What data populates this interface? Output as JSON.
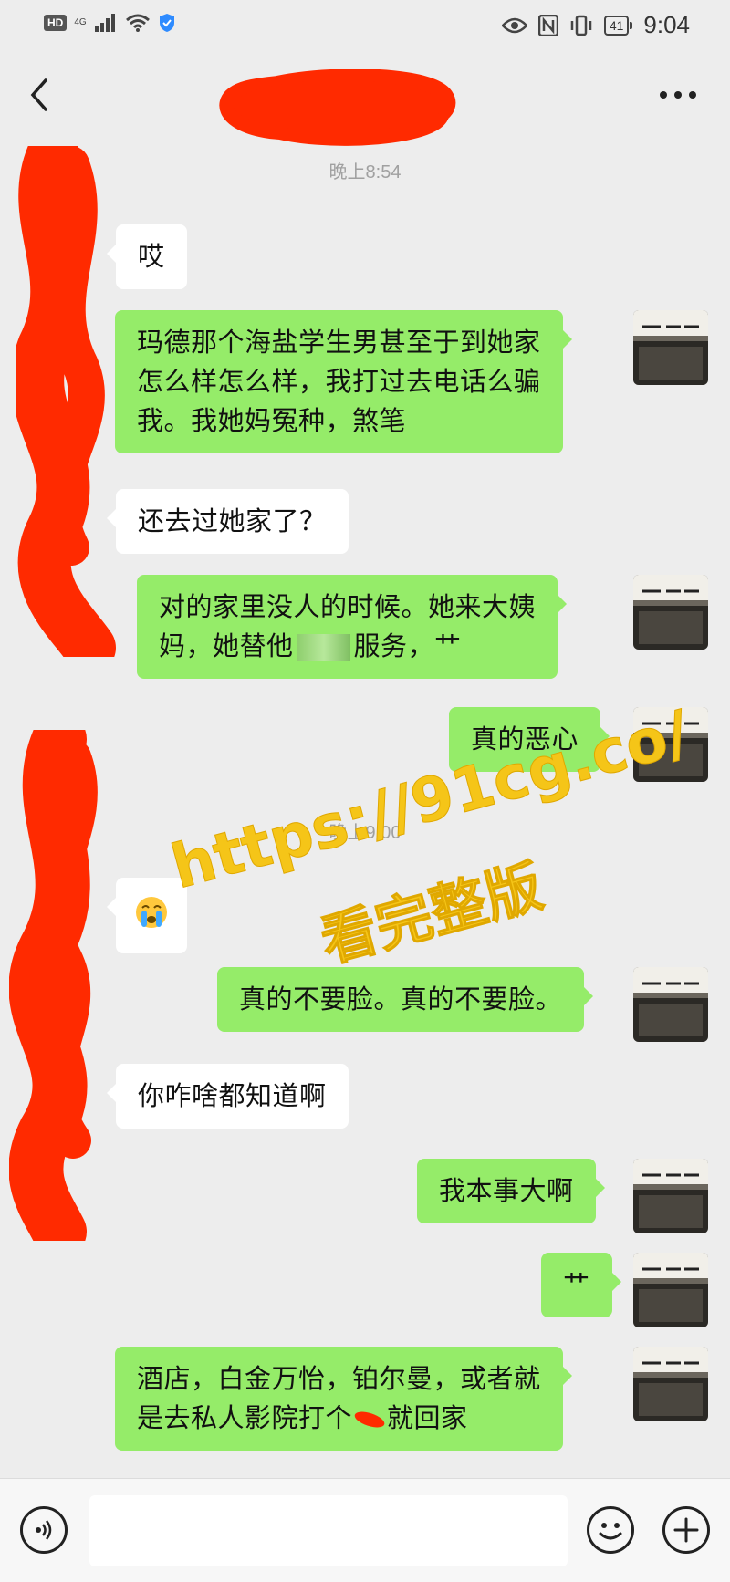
{
  "status_bar": {
    "hd_label": "HD",
    "network_label": "4G",
    "battery_level": "41",
    "time": "9:04"
  },
  "timestamps": [
    "晚上8:54",
    "晚上9:00"
  ],
  "messages": [
    {
      "side": "in",
      "text": "哎"
    },
    {
      "side": "out",
      "lines": [
        "玛德那个海盐学生男甚至于到她家",
        "怎么样怎么样，我打过去电话么骗",
        "我。我她妈冤种，煞笔"
      ]
    },
    {
      "side": "in",
      "text": "还去过她家了？"
    },
    {
      "side": "out",
      "lines": [
        "对的家里没人的时候。她来大姨",
        "妈，她替他",
        "服务，艹"
      ]
    },
    {
      "side": "out",
      "text": "真的恶心"
    },
    {
      "side": "in",
      "emoji": "sob-emoji"
    },
    {
      "side": "out",
      "text": "真的不要脸。真的不要脸。"
    },
    {
      "side": "in",
      "text": "你咋啥都知道啊"
    },
    {
      "side": "out",
      "text": "我本事大啊"
    },
    {
      "side": "out",
      "text": "艹"
    },
    {
      "side": "out",
      "lines": [
        "酒店，白金万怡，铂尔曼，或者就",
        "是去私人影院打个",
        "就回家"
      ]
    }
  ],
  "watermark": {
    "url": "https://91cg.co/",
    "tagline": "看完整版",
    "color": "#f5c518"
  },
  "colors": {
    "background": "#ededed",
    "incoming_bubble": "#ffffff",
    "outgoing_bubble": "#95ec69",
    "redaction": "#ff2a00"
  },
  "input_bar": {
    "placeholder": ""
  },
  "icons": {
    "back": "back-arrow-icon",
    "more": "more-dots-icon",
    "voice": "voice-icon",
    "emoji": "emoji-icon",
    "plus": "plus-icon"
  }
}
